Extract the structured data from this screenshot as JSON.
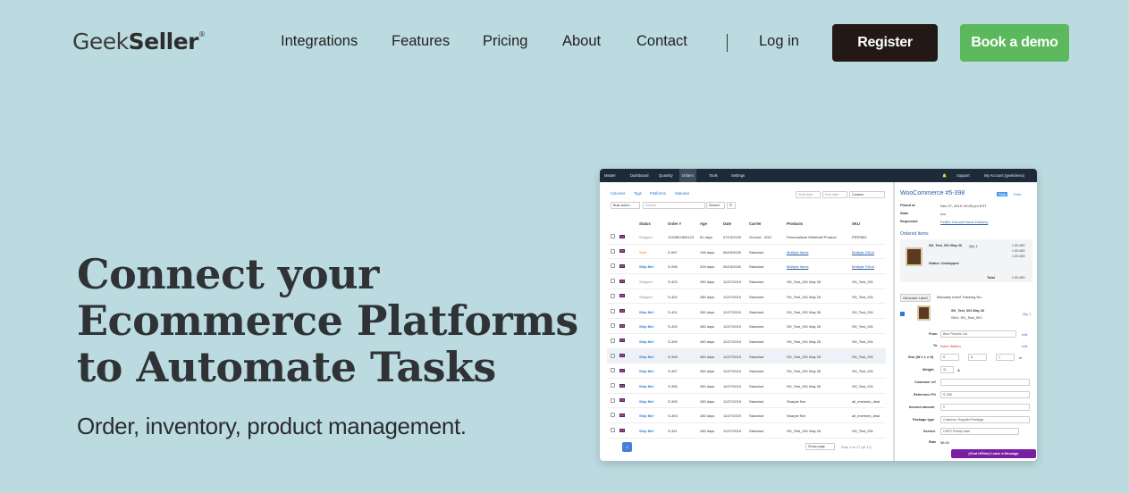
{
  "brand": {
    "light": "Geek",
    "bold": "Seller",
    "mark": "®"
  },
  "nav": {
    "links": [
      "Integrations",
      "Features",
      "Pricing",
      "About",
      "Contact"
    ],
    "login": "Log in",
    "register": "Register",
    "demo": "Book a demo"
  },
  "hero": {
    "title_lines": [
      "Connect your",
      "Ecommerce Platforms",
      "to Automate Tasks"
    ],
    "subtitle": "Order, inventory, product management."
  },
  "app": {
    "topbar": {
      "items": [
        "Master",
        "Dashboard",
        "Quantity",
        "Orders",
        "Tools",
        "Settings"
      ],
      "support": "Support",
      "account": "My Account (geekdemo)"
    },
    "filters": [
      "Columns",
      "Tags",
      "Platforms",
      "Statuses"
    ],
    "bulk": "Bulk action",
    "search_placeholder": "Search",
    "search_btn": "Search",
    "date_start": "Start date",
    "date_end": "End date",
    "date_range": "Custom",
    "columns": [
      "Status",
      "Order #",
      "Age",
      "Date",
      "Carrier",
      "Products",
      "SKU"
    ],
    "rows": [
      {
        "status": "Shipped",
        "order": "1234567890123",
        "age": "81 days",
        "date": "07/13/2020",
        "carrier": "Ground - 2DG",
        "product": "Personalized Whitehall Product",
        "sku": "PERSBG"
      },
      {
        "status": "Sent",
        "order": "S-997",
        "age": "196 days",
        "date": "05/19/2020",
        "carrier": "Standard",
        "product": "Multiple items",
        "sku": "Multiple SKUs"
      },
      {
        "status": "Ship Me!",
        "order": "S-996",
        "age": "239 days",
        "date": "05/13/2020",
        "carrier": "Standard",
        "product": "Multiple items",
        "sku": "Multiple SKUs"
      },
      {
        "status": "Shipped",
        "order": "S-403",
        "age": "280 days",
        "date": "12/27/2019",
        "carrier": "Standard",
        "product": "SH_Test_001 May 26",
        "sku": "SH_Test_001"
      },
      {
        "status": "Shipped",
        "order": "S-402",
        "age": "280 days",
        "date": "12/27/2019",
        "carrier": "Standard",
        "product": "SH_Test_001 May 26",
        "sku": "SH_Test_001"
      },
      {
        "status": "Ship Me!",
        "order": "S-401",
        "age": "280 days",
        "date": "12/27/2019",
        "carrier": "Standard",
        "product": "SH_Test_001 May 26",
        "sku": "SH_Test_001"
      },
      {
        "status": "Ship Me!",
        "order": "S-400",
        "age": "280 days",
        "date": "12/27/2019",
        "carrier": "Standard",
        "product": "SH_Test_001 May 26",
        "sku": "SH_Test_001"
      },
      {
        "status": "Ship Me!",
        "order": "S-399",
        "age": "280 days",
        "date": "12/27/2019",
        "carrier": "Standard",
        "product": "SH_Test_001 May 26",
        "sku": "SH_Test_001"
      },
      {
        "status": "Ship Me!",
        "order": "S-398",
        "age": "280 days",
        "date": "12/27/2019",
        "carrier": "Standard",
        "product": "SH_Test_001 May 26",
        "sku": "SH_Test_001"
      },
      {
        "status": "Ship Me!",
        "order": "S-397",
        "age": "280 days",
        "date": "12/27/2019",
        "carrier": "Standard",
        "product": "SH_Test_001 May 26",
        "sku": "SH_Test_001"
      },
      {
        "status": "Ship Me!",
        "order": "S-396",
        "age": "280 days",
        "date": "12/27/2019",
        "carrier": "Standard",
        "product": "SH_Test_001 May 26",
        "sku": "SH_Test_001"
      },
      {
        "status": "Ship Me!",
        "order": "S-395",
        "age": "280 days",
        "date": "12/27/2019",
        "carrier": "Standard",
        "product": "Sharpie fine",
        "sku": "all_enemies_deal"
      },
      {
        "status": "Ship Me!",
        "order": "S-393",
        "age": "280 days",
        "date": "12/27/2019",
        "carrier": "Standard",
        "product": "Sharpie fine",
        "sku": "all_enemies_deal"
      },
      {
        "status": "Ship Me!",
        "order": "S-391",
        "age": "280 days",
        "date": "12/27/2019",
        "carrier": "Standard",
        "product": "SH_Test_001 May 26",
        "sku": "SH_Test_001"
      }
    ],
    "page": "1",
    "page_size": "Show page",
    "page_info": "Row 1 to 17 (of 17)",
    "detail": {
      "title": "WooCommerce #5-398",
      "badge": "Ship",
      "print": "Print",
      "fields": [
        {
          "label": "Placed at",
          "value": "Dec 27, 2019, 09:05 pm EST"
        },
        {
          "label": "State",
          "value": "n/a"
        },
        {
          "label": "Requested",
          "value": "FedEx Ground Home Delivery"
        }
      ],
      "ordered_items": "Ordered items",
      "item_name": "SH_Test_001 May 26",
      "item_qty": "Qty 1",
      "price_rows": [
        "1.00 USD",
        "1.00 USD",
        "1.00 USD"
      ],
      "total_label": "Total",
      "total_value": "1.00 USD",
      "status_text": "Status: Unshipped",
      "tab_generate": "Generate Label",
      "tab_manual": "Manually Insert Tracking No.",
      "sel_item": "SH_Test_001 May 26",
      "sel_sku": "SKU: SH_Test_001",
      "sel_qty": "Qty 1",
      "form": {
        "from_label": "From",
        "from_value": "Blue Flowers Ltd",
        "edit": "edit",
        "to_label": "To",
        "to_value": "Dave Walton",
        "size_label": "Size (W x L x H)",
        "size_w": "8",
        "size_l": "8",
        "size_h": "1",
        "size_unit": "in",
        "weight_label": "Weight",
        "weight_value": "11",
        "weight_unit": "lb",
        "cref_label": "Customer ref",
        "refpo_label": "Reference PO",
        "refpo_value": "S-398",
        "insured_label": "Insured amount",
        "insured_value": "0",
        "pkg_label": "Package type",
        "pkg_value": "Customer Supplied Package",
        "service_label": "Service",
        "service_value": "USPS Priority Mail",
        "rate_label": "Rate",
        "rate_value": "$8.50"
      },
      "chat": "(Chat Offline) Leave a Message"
    }
  }
}
